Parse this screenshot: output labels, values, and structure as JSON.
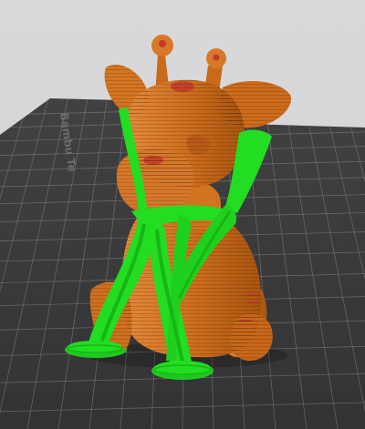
{
  "viewport": {
    "mode": "preview",
    "background_color": "#d6d6d8"
  },
  "build_plate": {
    "label": "Bambu Te",
    "surface_color": "#3b3b3d",
    "grid_color": "#8a8a8a",
    "edge_color": "#2a2a2b"
  },
  "model": {
    "name": "giraffe",
    "color": "#cc6d1c",
    "highlight_color": "#e48a34",
    "seam_color": "#c43a2a"
  },
  "supports": {
    "type": "tree",
    "color": "#22dd22",
    "shade_color": "#17b517"
  }
}
